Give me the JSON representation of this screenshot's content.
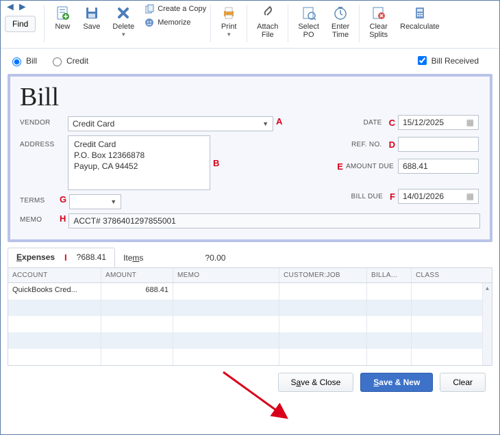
{
  "toolbar": {
    "find": "Find",
    "new": "New",
    "save": "Save",
    "delete": "Delete",
    "create_copy": "Create a Copy",
    "memorize": "Memorize",
    "print": "Print",
    "attach_file": "Attach\nFile",
    "select_po": "Select\nPO",
    "enter_time": "Enter\nTime",
    "clear_splits": "Clear\nSplits",
    "recalculate": "Recalculate"
  },
  "type": {
    "bill": "Bill",
    "credit": "Credit",
    "received": "Bill Received"
  },
  "bill": {
    "title": "Bill",
    "labels": {
      "vendor": "VENDOR",
      "address": "ADDRESS",
      "terms": "TERMS",
      "memo": "MEMO",
      "date": "DATE",
      "ref_no": "REF. NO.",
      "amount_due": "AMOUNT DUE",
      "bill_due": "BILL DUE"
    },
    "vendor": "Credit Card",
    "address": "Credit Card\nP.O. Box 12366878\nPayup, CA 94452",
    "date": "15/12/2025",
    "ref_no": "",
    "amount_due": "688.41",
    "bill_due": "14/01/2026",
    "terms": "",
    "memo": "ACCT# 3786401297855001",
    "markers": {
      "vendor": "A",
      "address": "B",
      "date": "C",
      "ref_no": "D",
      "amount_due": "E",
      "bill_due": "F",
      "terms": "G",
      "memo": "H",
      "tabs": "I"
    }
  },
  "tabs": {
    "expenses_label": "Expenses",
    "expenses_amount": "?688.41",
    "items_label": "Items",
    "items_amount": "?0.00"
  },
  "grid": {
    "columns": {
      "account": "ACCOUNT",
      "amount": "AMOUNT",
      "memo": "MEMO",
      "customer_job": "CUSTOMER:JOB",
      "billable": "BILLA...",
      "class": "CLASS"
    },
    "rows": [
      {
        "account": "QuickBooks Cred...",
        "amount": "688.41",
        "memo": "",
        "customer_job": "",
        "billable": "",
        "class": ""
      }
    ]
  },
  "buttons": {
    "save_close": "Save & Close",
    "save_new": "Save & New",
    "clear": "Clear"
  }
}
